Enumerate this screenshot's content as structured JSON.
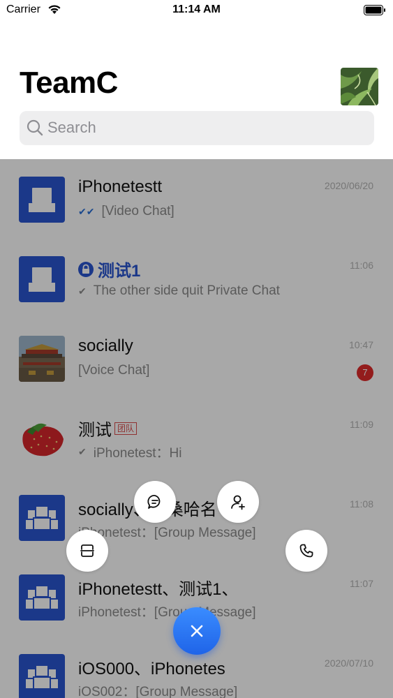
{
  "status_bar": {
    "carrier": "Carrier",
    "time": "11:14 AM"
  },
  "header": {
    "title": "TeamC"
  },
  "search": {
    "placeholder": "Search"
  },
  "conversations": [
    {
      "name": "iPhonetestt",
      "time": "2020/06/20",
      "message": "[Video Chat]",
      "tick": "read",
      "avatar": "user-icon"
    },
    {
      "name": "测试1",
      "time": "11:06",
      "message": "The other side quit Private Chat",
      "tick": "sent",
      "avatar": "user-icon",
      "private": true
    },
    {
      "name": "socially",
      "time": "10:47",
      "message": "[Voice Chat]",
      "unread": "7",
      "avatar": "palace-photo"
    },
    {
      "name": "测试",
      "tag": "团队",
      "time": "11:09",
      "message": "iPhonetest：Hi",
      "tick": "sent",
      "avatar": "strawberry-photo"
    },
    {
      "name": "socially、旗桑哈名",
      "time": "11:08",
      "message": "iPhonetest：[Group Message]",
      "avatar": "group-icon"
    },
    {
      "name": "iPhonetestt、测试1、",
      "time": "11:07",
      "message": "iPhonetest：[Group Message]",
      "avatar": "group-icon"
    },
    {
      "name": "iOS000、iPhonetes",
      "time": "2020/07/10",
      "message": "iOS002：[Group Message]",
      "avatar": "group-icon"
    }
  ],
  "fab_menu": {
    "items": [
      "message-icon",
      "add-contact-icon",
      "scan-icon",
      "phone-icon"
    ],
    "close": "close-icon"
  },
  "colors": {
    "accent": "#2a56d0",
    "fab": "#2f78f5",
    "badge": "#e02b2b"
  }
}
